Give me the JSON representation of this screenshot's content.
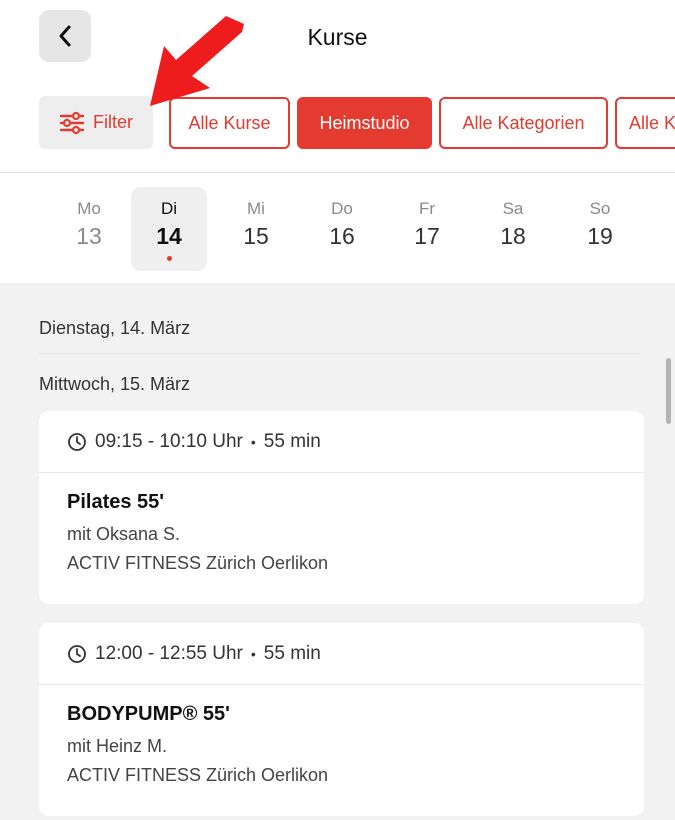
{
  "header": {
    "title": "Kurse",
    "back_icon": "chevron-left-icon"
  },
  "filters": {
    "filter_label": "Filter",
    "filter_icon": "sliders-icon",
    "chips": [
      {
        "label": "Alle Kurse",
        "active": false
      },
      {
        "label": "Heimstudio",
        "active": true
      },
      {
        "label": "Alle Kategorien",
        "active": false
      },
      {
        "label": "Alle K",
        "active": false
      }
    ]
  },
  "days": [
    {
      "name": "Mo",
      "date": "13"
    },
    {
      "name": "Di",
      "date": "14"
    },
    {
      "name": "Mi",
      "date": "15"
    },
    {
      "name": "Do",
      "date": "16"
    },
    {
      "name": "Fr",
      "date": "17"
    },
    {
      "name": "Sa",
      "date": "18"
    },
    {
      "name": "So",
      "date": "19"
    }
  ],
  "sections": {
    "tuesday": "Dienstag, 14. März",
    "wednesday": "Mittwoch, 15. März"
  },
  "classes": [
    {
      "time": "09:15 - 10:10 Uhr",
      "duration": "55 min",
      "title": "Pilates 55'",
      "instructor": "mit Oksana S.",
      "location": "ACTIV FITNESS Zürich Oerlikon"
    },
    {
      "time": "12:00 - 12:55 Uhr",
      "duration": "55 min",
      "title": "BODYPUMP® 55'",
      "instructor": "mit Heinz M.",
      "location": "ACTIV FITNESS Zürich Oerlikon"
    }
  ],
  "colors": {
    "accent": "#e53a2f",
    "list_background": "#f2f2f2"
  }
}
